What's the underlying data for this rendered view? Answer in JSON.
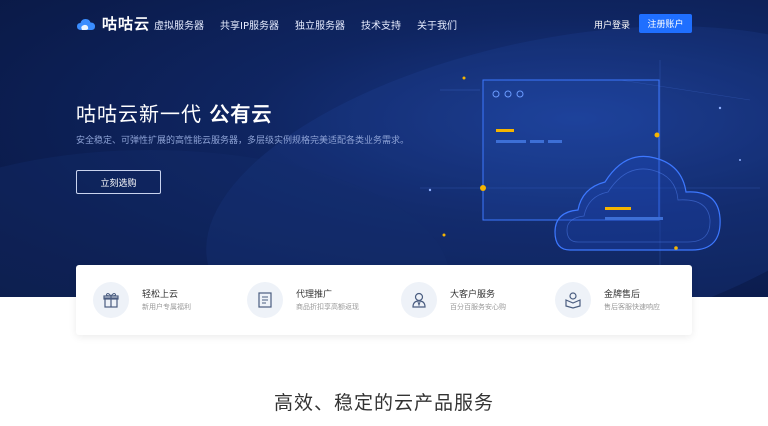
{
  "nav": {
    "logo_text": "咕咕云",
    "links": [
      "虚拟服务器",
      "共享IP服务器",
      "独立服务器",
      "技术支持",
      "关于我们"
    ],
    "login": "用户登录",
    "register": "注册账户"
  },
  "hero": {
    "title_prefix": "咕咕云新一代 ",
    "title_bold": "公有云",
    "subtitle": "安全稳定、可弹性扩展的高性能云服务器，多层级实例规格完美适配各类业务需求。",
    "cta": "立刻选购"
  },
  "features": [
    {
      "icon": "gift-icon",
      "title": "轻松上云",
      "desc": "新用户专属福利"
    },
    {
      "icon": "document-icon",
      "title": "代理推广",
      "desc": "商品折扣享高额返现"
    },
    {
      "icon": "user-service-icon",
      "title": "大客户服务",
      "desc": "百分百服务安心购"
    },
    {
      "icon": "after-sales-icon",
      "title": "金牌售后",
      "desc": "售后客服快速响应"
    }
  ],
  "section": {
    "title": "高效、稳定的云产品服务"
  },
  "colors": {
    "hero_bg": "#0b1c4d",
    "accent": "#1f6fff",
    "highlight": "#f5b400"
  }
}
